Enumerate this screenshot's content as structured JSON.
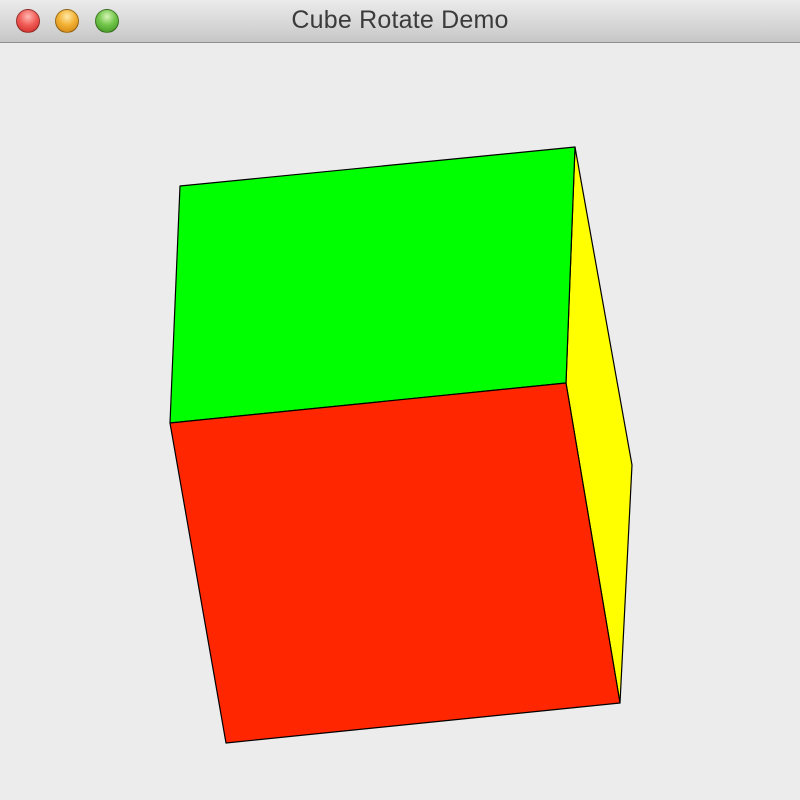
{
  "window": {
    "title": "Cube Rotate Demo"
  },
  "cube": {
    "faces": [
      {
        "name": "top-face",
        "color": "#00ff00"
      },
      {
        "name": "front-face",
        "color": "#ff2600"
      },
      {
        "name": "right-face",
        "color": "#ffff00"
      }
    ],
    "edge_color": "#000000"
  }
}
